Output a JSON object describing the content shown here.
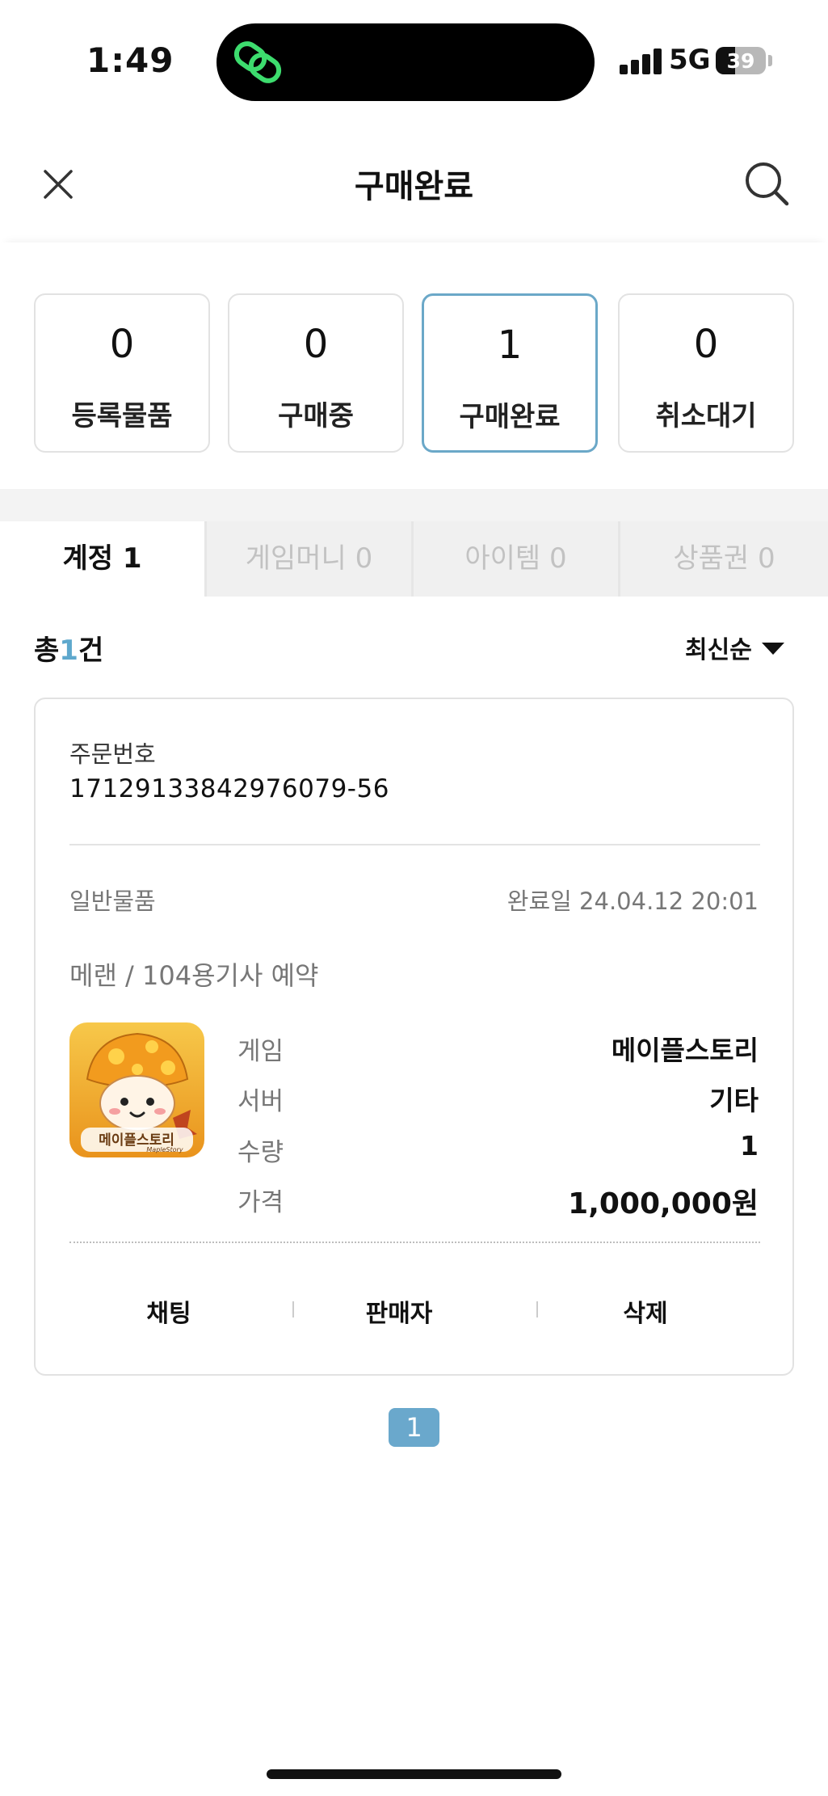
{
  "status_bar": {
    "time": "1:49",
    "network": "5G",
    "battery": "39",
    "battery_level": 0.39
  },
  "header": {
    "title": "구매완료"
  },
  "summary": [
    {
      "count": "0",
      "label": "등록물품",
      "active": false
    },
    {
      "count": "0",
      "label": "구매중",
      "active": false
    },
    {
      "count": "1",
      "label": "구매완료",
      "active": true
    },
    {
      "count": "0",
      "label": "취소대기",
      "active": false
    }
  ],
  "tabs": [
    {
      "label": "계정 1",
      "active": true
    },
    {
      "label": "게임머니 0",
      "active": false
    },
    {
      "label": "아이템 0",
      "active": false
    },
    {
      "label": "상품권 0",
      "active": false
    }
  ],
  "list": {
    "total_prefix": "총",
    "total_count": "1",
    "total_suffix": "건",
    "sort_label": "최신순"
  },
  "order": {
    "order_no_label": "주문번호",
    "order_no": "17129133842976079-56",
    "item_type": "일반물품",
    "done_date": "완료일 24.04.12 20:01",
    "item_title": "메랜 / 104용기사 예약",
    "logo_text": "메이플스토리",
    "logo_subtext": "MapleStory",
    "details": [
      {
        "label": "게임",
        "value": "메이플스토리"
      },
      {
        "label": "서버",
        "value": "기타"
      },
      {
        "label": "수량",
        "value": "1"
      },
      {
        "label": "가격",
        "value": "1,000,000원"
      }
    ],
    "actions": [
      "채팅",
      "판매자",
      "삭제"
    ]
  },
  "pagination": {
    "current_page": "1"
  },
  "colors": {
    "accent": "#6aa8cc",
    "active_border": "#6ba8c8",
    "island_logo": "#3ddc6e"
  }
}
